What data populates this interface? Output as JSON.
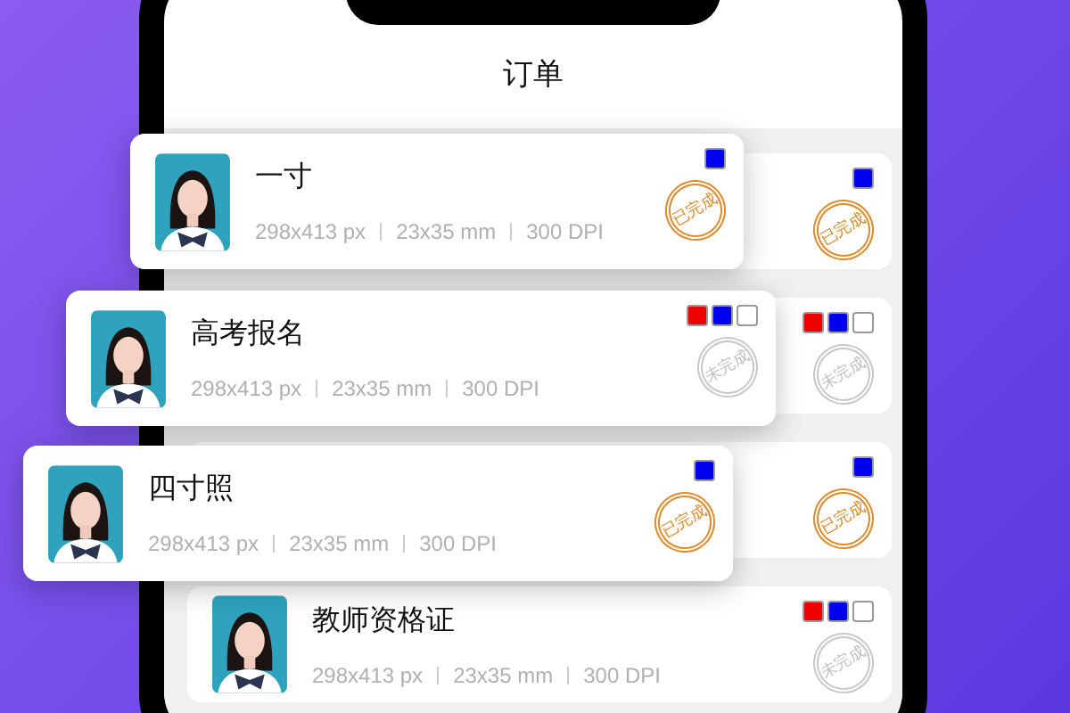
{
  "screen": {
    "title": "订单"
  },
  "list": [
    {
      "swatches": [
        {
          "color": "#0000ee"
        }
      ],
      "status": {
        "kind": "done",
        "label": "已完成"
      }
    },
    {
      "swatches": [
        {
          "color": "#ee0000"
        },
        {
          "color": "#0000ee"
        },
        {
          "color": "#ffffff"
        }
      ],
      "status": {
        "kind": "pending",
        "label": "未完成"
      }
    },
    {
      "swatches": [
        {
          "color": "#0000ee"
        }
      ],
      "status": {
        "kind": "done",
        "label": "已完成"
      }
    },
    {
      "name": "教师资格证",
      "px": "298x413 px",
      "mm": "23x35 mm",
      "dpi": "300 DPI",
      "swatches": [
        {
          "color": "#ee0000"
        },
        {
          "color": "#0000ee"
        },
        {
          "color": "#ffffff"
        }
      ],
      "status": {
        "kind": "pending",
        "label": "未完成"
      }
    }
  ],
  "floating_cards": [
    {
      "name": "一寸",
      "px": "298x413 px",
      "mm": "23x35 mm",
      "dpi": "300 DPI",
      "swatches": [
        {
          "color": "#0000ee"
        }
      ],
      "status": {
        "kind": "done",
        "label": "已完成"
      }
    },
    {
      "name": "高考报名",
      "px": "298x413 px",
      "mm": "23x35 mm",
      "dpi": "300 DPI",
      "swatches": [
        {
          "color": "#ee0000"
        },
        {
          "color": "#0000ee"
        },
        {
          "color": "#ffffff"
        }
      ],
      "status": {
        "kind": "pending",
        "label": "未完成"
      }
    },
    {
      "name": "四寸照",
      "px": "298x413 px",
      "mm": "23x35 mm",
      "dpi": "300 DPI",
      "swatches": [
        {
          "color": "#0000ee"
        }
      ],
      "status": {
        "kind": "done",
        "label": "已完成"
      }
    }
  ]
}
